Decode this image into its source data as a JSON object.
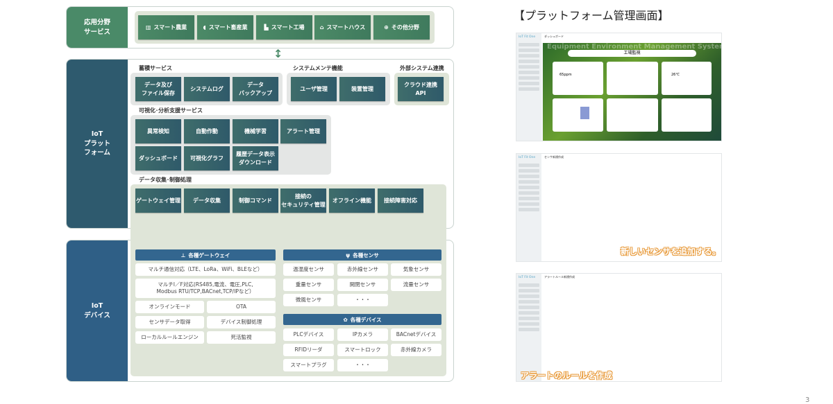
{
  "application": {
    "label": "応用分野\nサービス",
    "items": [
      {
        "label": "スマート農業",
        "icon": "greenhouse-icon"
      },
      {
        "label": "スマート畜産業",
        "icon": "pig-icon"
      },
      {
        "label": "スマート工場",
        "icon": "factory-icon"
      },
      {
        "label": "スマートハウス",
        "icon": "house-icon"
      },
      {
        "label": "その他分野",
        "icon": "globe-icon"
      }
    ]
  },
  "platform": {
    "label": "IoT\nプラット\nフォーム",
    "storage": {
      "title": "蓄積サービス",
      "items": [
        "データ及び\nファイル保存",
        "システムログ",
        "データ\nバックアップ"
      ]
    },
    "maintenance": {
      "title": "システムメンテ機能",
      "items": [
        "ユーザ管理",
        "装置管理"
      ]
    },
    "external": {
      "title": "外部システム連携",
      "items": [
        "クラウド連携\nAPI"
      ]
    },
    "visualization": {
      "title": "可視化･分析支援サービス",
      "items": [
        "異常検知",
        "自動作動",
        "機械学習",
        "アラート管理",
        "ダッシュボード",
        "可視化グラフ",
        "履歴データ表示\nダウンロード"
      ]
    },
    "collection": {
      "title": "データ収集･制御処理",
      "items": [
        "ゲートウェイ管理",
        "データ収集",
        "制御コマンド",
        "接続の\nセキュリティ管理",
        "オフライン機能",
        "接続障害対応"
      ]
    }
  },
  "devices": {
    "label": "IoT\nデバイス",
    "gateway": {
      "title": "各種ゲートウェイ",
      "icon": "gateway-icon",
      "items": [
        "マルチ通信対応（LTE、LoRa、WiFi、BLEなど）",
        "マルチI／F対応(RS485,電流、電圧,PLC,\nModbus RTU/TCP,BACnet,TCP/IPなど）",
        "オンラインモード",
        "OTA",
        "センサデータ取得",
        "デバイス制御処理",
        "ローカルルールエンジン",
        "死活監視"
      ]
    },
    "sensors": {
      "title": "各種センサ",
      "icon": "antenna-icon",
      "items": [
        "温湿度センサ",
        "赤外線センサ",
        "気象センサ",
        "重量センサ",
        "開閉センサ",
        "流量センサ",
        "微風センサ",
        "・・・"
      ]
    },
    "devices": {
      "title": "各種デバイス",
      "icon": "gear-icon",
      "items": [
        "PLCデバイス",
        "IPカメラ",
        "BACnetデバイス",
        "RFIDリーダ",
        "スマートロック",
        "赤外線カメラ",
        "スマートプラグ",
        "・・・"
      ]
    }
  },
  "right": {
    "title": "【プラットフォーム管理画面】",
    "screens": [
      {
        "logo": "IoT Fit One",
        "page": "ダッシュボード",
        "banner": "工場監視",
        "co2": "65ppm",
        "temp": "26℃",
        "watermark": "Equipment Environment Management System"
      },
      {
        "logo": "IoT Fit One",
        "page": "センサ新規作成",
        "caption": "新しいセンサを追加する。"
      },
      {
        "logo": "IoT Fit One",
        "page": "アラートルール新規作成",
        "caption": "アラートのルールを作成"
      }
    ]
  },
  "page_number": "3",
  "colors": {
    "app_green": "#4a8a68",
    "platform_teal": "#2e5a6e",
    "device_blue": "#2f5f86"
  }
}
